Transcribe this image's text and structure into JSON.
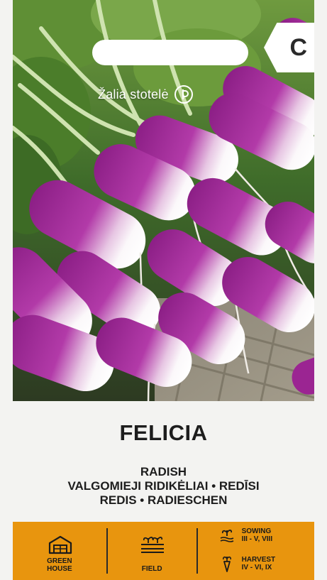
{
  "packet": {
    "brand": "Žalia stotelė",
    "class_letter": "C",
    "variety": "FELICIA",
    "names": [
      "RADISH",
      "VALGOMIEJI RIDIKĖLIAI • REDĪSI",
      "REDIS • RADIESCHEN"
    ]
  },
  "info_bar": {
    "greenhouse_line1": "GREEN",
    "greenhouse_line2": "HOUSE",
    "field": "FIELD",
    "sowing_label": "SOWING",
    "sowing_months": "III - V, VIII",
    "harvest_label": "HARVEST",
    "harvest_months": "IV - VI, IX"
  },
  "colors": {
    "bar": "#e8950e",
    "radish_purple": "#a32c9b",
    "radish_white": "#f7f3f5",
    "leaf_green": "#4e7f2e"
  },
  "icons": [
    "greenhouse-icon",
    "field-icon",
    "sowing-icon",
    "harvest-icon",
    "brand-logo-icon"
  ]
}
